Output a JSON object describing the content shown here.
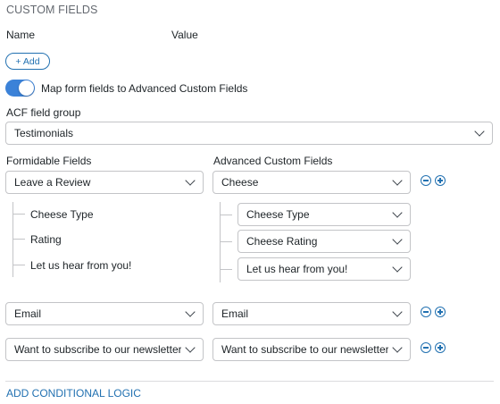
{
  "section": {
    "title": "CUSTOM FIELDS",
    "name_header": "Name",
    "value_header": "Value",
    "add_label": "+ Add"
  },
  "toggle": {
    "label": "Map form fields to Advanced Custom Fields",
    "checked": true
  },
  "acf_group": {
    "label": "ACF field group",
    "selected": "Testimonials"
  },
  "columns": {
    "formidable": "Formidable Fields",
    "acf": "Advanced Custom Fields"
  },
  "mappings": [
    {
      "formidable": "Leave a Review",
      "acf": "Cheese",
      "subfields": [
        {
          "formidable": "Cheese Type",
          "acf": "Cheese Type"
        },
        {
          "formidable": "Rating",
          "acf": "Cheese Rating"
        },
        {
          "formidable": "Let us hear from you!",
          "acf": "Let us hear from you!"
        }
      ]
    },
    {
      "formidable": "Email",
      "acf": "Email"
    },
    {
      "formidable": "Want to subscribe to our newsletter?",
      "acf": "Want to subscribe to our newsletter?"
    }
  ],
  "conditional_logic_label": "ADD CONDITIONAL LOGIC",
  "colors": {
    "accent": "#2271b1",
    "toggle_on": "#3b82d8",
    "border": "#c3c4c7"
  },
  "icons": [
    "minus-circle-icon",
    "plus-circle-icon",
    "chevron-down-icon"
  ]
}
